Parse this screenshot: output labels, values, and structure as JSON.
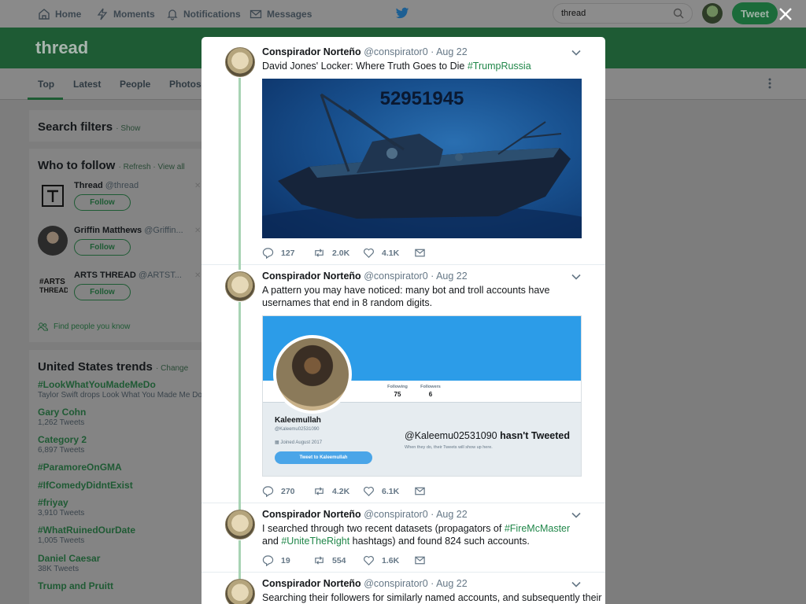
{
  "nav": {
    "home": "Home",
    "moments": "Moments",
    "notifications": "Notifications",
    "messages": "Messages",
    "search_value": "thread",
    "tweet_button": "Tweet"
  },
  "page": {
    "title": "thread",
    "tabs": [
      "Top",
      "Latest",
      "People",
      "Photos"
    ]
  },
  "search_filters": {
    "title": "Search filters",
    "link": "· Show"
  },
  "who_to_follow": {
    "title": "Who to follow",
    "links": "· Refresh · View all",
    "follow_label": "Follow",
    "accounts": [
      {
        "name": "Thread",
        "handle": "@thread"
      },
      {
        "name": "Griffin Matthews",
        "handle": "@Griffin..."
      },
      {
        "name": "ARTS THREAD",
        "handle": "@ARTST..."
      }
    ],
    "find_people": "Find people you know"
  },
  "trends": {
    "title": "United States trends",
    "change": "· Change",
    "items": [
      {
        "name": "#LookWhatYouMadeMeDo",
        "sub": "Taylor Swift drops Look What You Made Me Do"
      },
      {
        "name": "Gary Cohn",
        "sub": "1,262 Tweets"
      },
      {
        "name": "Category 2",
        "sub": "6,897 Tweets"
      },
      {
        "name": "#ParamoreOnGMA",
        "sub": ""
      },
      {
        "name": "#IfComedyDidntExist",
        "sub": ""
      },
      {
        "name": "#friyay",
        "sub": "3,910 Tweets"
      },
      {
        "name": "#WhatRuinedOurDate",
        "sub": "1,005 Tweets"
      },
      {
        "name": "Daniel Caesar",
        "sub": "38K Tweets"
      },
      {
        "name": "Trump and Pruitt",
        "sub": ""
      }
    ]
  },
  "thread": {
    "tweets": [
      {
        "author": "Conspirador Norteño",
        "meta": "@conspirator0 · Aug 22",
        "text_before": "David Jones' Locker: Where Truth Goes to Die ",
        "hashtag": "#TrumpRussia",
        "image_number": "52951945",
        "replies": "127",
        "retweets": "2.0K",
        "likes": "4.1K"
      },
      {
        "author": "Conspirador Norteño",
        "meta": "@conspirator0 · Aug 22",
        "text": "A pattern you may have noticed: many bot and troll accounts have usernames that end in 8 random digits.",
        "profile": {
          "following_label": "Following",
          "following": "75",
          "followers_label": "Followers",
          "followers": "6",
          "name": "Kaleemullah",
          "handle": "@Kaleemu02531090",
          "joined": "Joined August 2017",
          "button": "Tweet to Kaleemullah",
          "headline_handle": "@Kaleemu02531090",
          "headline_rest": " hasn't Tweeted",
          "subline": "When they do, their Tweets will show up here."
        },
        "replies": "270",
        "retweets": "4.2K",
        "likes": "6.1K"
      },
      {
        "author": "Conspirador Norteño",
        "meta": "@conspirator0 · Aug 22",
        "t1": "I searched through two recent datasets (propagators of ",
        "h1": "#FireMcMaster",
        "t2": " and ",
        "h2": "#UniteTheRight",
        "t3": " hashtags) and found 824 such accounts.",
        "replies": "19",
        "retweets": "554",
        "likes": "1.6K"
      },
      {
        "author": "Conspirador Norteño",
        "meta": "@conspirator0 · Aug 22",
        "text": "Searching their followers for similarly named accounts, and subsequently their"
      }
    ]
  },
  "colors": {
    "brand_green": "#1e5b34",
    "hashtag_green": "#21874a",
    "thread_line": "#a8d3b4"
  }
}
